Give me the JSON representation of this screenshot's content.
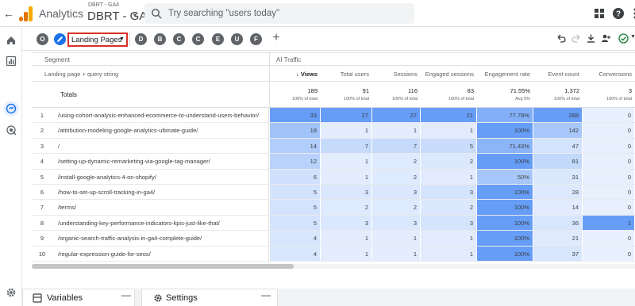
{
  "topbar": {
    "app_name": "Analytics",
    "property_account": "DBRT - GA4",
    "property_name": "DBRT - GA4",
    "search_placeholder": "Try searching \"users today\""
  },
  "tabs": {
    "left_circles": [
      "O"
    ],
    "active_tab_label": "Landing Pages",
    "other_circles": [
      "D",
      "B",
      "C",
      "C",
      "E",
      "U",
      "F"
    ],
    "add_label": "+"
  },
  "table": {
    "segment_label": "Segment",
    "segment_value": "AI Traffic",
    "dimension_header": "Landing page + query string",
    "metric_headers": [
      "↓ Views",
      "Total users",
      "Sessions",
      "Engaged sessions",
      "Engagement rate",
      "Event count",
      "Conversions"
    ],
    "totals_label": "Totals",
    "totals": [
      {
        "value": "189",
        "sub": "100% of total"
      },
      {
        "value": "91",
        "sub": "100% of total"
      },
      {
        "value": "116",
        "sub": "100% of total"
      },
      {
        "value": "83",
        "sub": "100% of total"
      },
      {
        "value": "71.55%",
        "sub": "Avg 0%"
      },
      {
        "value": "1,372",
        "sub": "100% of total"
      },
      {
        "value": "3",
        "sub": "100% of total"
      }
    ],
    "rows": [
      {
        "no": "1",
        "page": "/using-cohort-analysis-enhanced-ecommerce-to-understand-users-behavior/",
        "values": [
          "33",
          "27",
          "27",
          "21",
          "77.78%",
          "288",
          "0"
        ]
      },
      {
        "no": "2",
        "page": "/attribution-modeling-google-analytics-ultimate-guide/",
        "values": [
          "18",
          "1",
          "1",
          "1",
          "100%",
          "142",
          "0"
        ]
      },
      {
        "no": "3",
        "page": "/",
        "values": [
          "14",
          "7",
          "7",
          "5",
          "71.43%",
          "47",
          "0"
        ]
      },
      {
        "no": "4",
        "page": "/setting-up-dynamic-remarketing-via-google-tag-manager/",
        "values": [
          "12",
          "1",
          "2",
          "2",
          "100%",
          "81",
          "0"
        ]
      },
      {
        "no": "5",
        "page": "/install-google-analytics-4-on-shopify/",
        "values": [
          "6",
          "1",
          "2",
          "1",
          "50%",
          "31",
          "0"
        ]
      },
      {
        "no": "6",
        "page": "/how-to-set-up-scroll-tracking-in-ga4/",
        "values": [
          "5",
          "3",
          "3",
          "3",
          "100%",
          "28",
          "0"
        ]
      },
      {
        "no": "7",
        "page": "/terms/",
        "values": [
          "5",
          "2",
          "2",
          "2",
          "100%",
          "14",
          "0"
        ]
      },
      {
        "no": "8",
        "page": "/understanding-key-performance-indicators-kpis-just-like-that/",
        "values": [
          "5",
          "3",
          "3",
          "3",
          "100%",
          "36",
          "1"
        ]
      },
      {
        "no": "9",
        "page": "/organic-search-traffic-analysis-in-ga4-complete-guide/",
        "values": [
          "4",
          "1",
          "1",
          "1",
          "100%",
          "21",
          "0"
        ]
      },
      {
        "no": "10",
        "page": "/regular-expression-guide-for-seos/",
        "values": [
          "4",
          "1",
          "1",
          "1",
          "100%",
          "37",
          "0"
        ]
      }
    ]
  },
  "bottom": {
    "variables_label": "Variables",
    "settings_label": "Settings"
  },
  "colors": {
    "accent": "#1a73e8",
    "heat_max": "#7baaf7",
    "heat_mid": "#aecbfa",
    "heat_low": "#d2e3fc",
    "highlight_border": "#d93025"
  }
}
